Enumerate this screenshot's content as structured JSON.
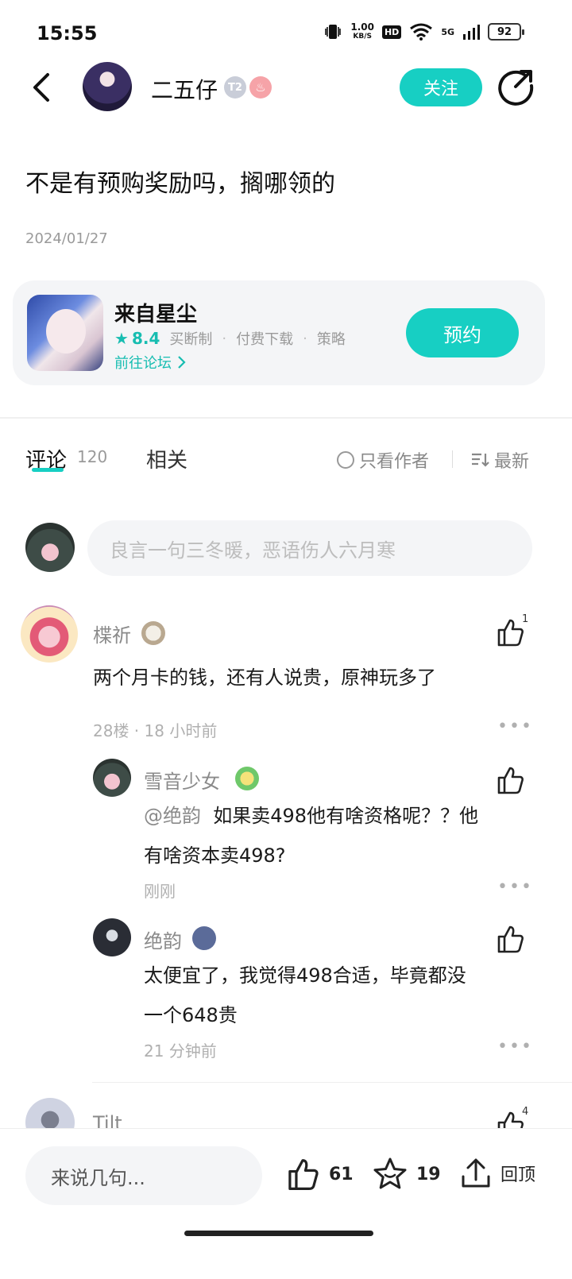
{
  "status": {
    "time": "15:55",
    "net_speed_value": "1.00",
    "net_speed_unit": "KB/S",
    "hd": "HD",
    "network": "5G",
    "battery": "92"
  },
  "header": {
    "author_name": "二五仔",
    "badge_level": "T2",
    "follow_label": "关注"
  },
  "post": {
    "title": "不是有预购奖励吗，搁哪领的",
    "date": "2024/01/27"
  },
  "game_card": {
    "name": "来自星尘",
    "rating": "8.4",
    "tags": [
      "买断制",
      "付费下载",
      "策略"
    ],
    "forum_link": "前往论坛",
    "reserve_label": "预约"
  },
  "tabs": {
    "comment_label": "评论",
    "comment_count": "120",
    "related_label": "相关",
    "only_author_label": "只看作者",
    "sort_label": "最新"
  },
  "composer": {
    "placeholder": "良言一句三冬暖，恶语伤人六月寒"
  },
  "comments": [
    {
      "user": "楪祈",
      "text": "两个月卡的钱，还有人说贵，原神玩多了",
      "meta": "28楼 · 18 小时前",
      "likes": "1",
      "replies": [
        {
          "user": "雪音少女",
          "mention": "@绝韵",
          "text_line1": "如果卖498他有啥资格呢？？他",
          "text_line2": "有啥资本卖498?",
          "meta": "刚刚"
        },
        {
          "user": "绝韵",
          "text_line1": "太便宜了，我觉得498合适，毕竟都没",
          "text_line2": "一个648贵",
          "meta": "21 分钟前"
        }
      ]
    },
    {
      "user": "Tilt",
      "likes": "4"
    }
  ],
  "bottom_bar": {
    "input_placeholder": "来说几句...",
    "likes": "61",
    "favorites": "19",
    "top_label": "回顶"
  },
  "colors": {
    "accent": "#17cfc3",
    "text_secondary": "#8a8a8a"
  }
}
